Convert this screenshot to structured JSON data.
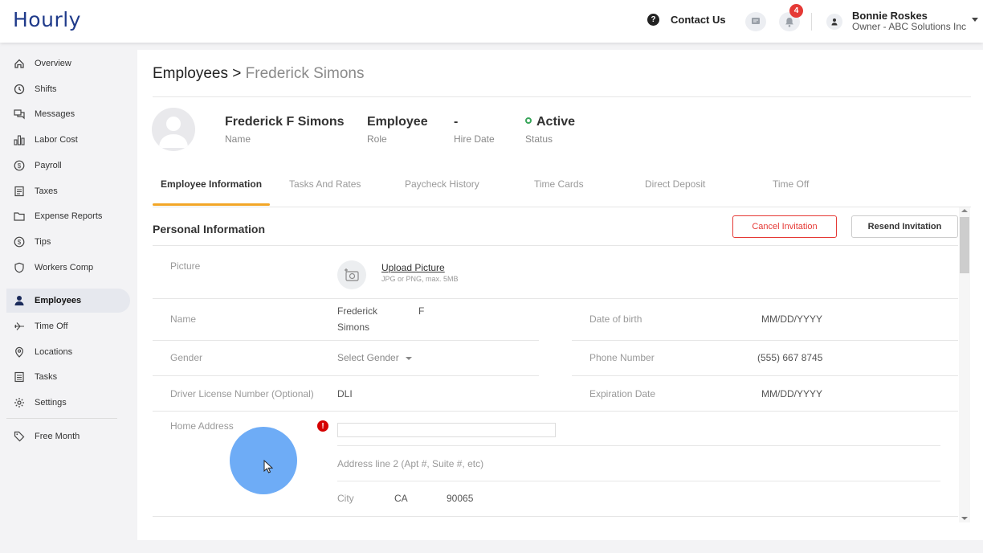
{
  "app": {
    "logo": "Hourly"
  },
  "topbar": {
    "contact_label": "Contact Us",
    "notifications_count": "4",
    "user_name": "Bonnie Roskes",
    "user_role": "Owner - ABC Solutions Inc",
    "icons": [
      "help-icon",
      "chat-icon",
      "bell-icon",
      "user-icon",
      "caret-down-icon"
    ]
  },
  "sidebar": {
    "items": [
      {
        "label": "Overview",
        "icon": "home-icon"
      },
      {
        "label": "Shifts",
        "icon": "clock-icon"
      },
      {
        "label": "Messages",
        "icon": "messages-icon"
      },
      {
        "label": "Labor Cost",
        "icon": "bar-chart-icon"
      },
      {
        "label": "Payroll",
        "icon": "dollar-circle-icon"
      },
      {
        "label": "Taxes",
        "icon": "document-icon"
      },
      {
        "label": "Expense Reports",
        "icon": "folder-icon"
      },
      {
        "label": "Tips",
        "icon": "dollar-circle-icon"
      },
      {
        "label": "Workers Comp",
        "icon": "shield-icon"
      },
      {
        "label": "Employees",
        "icon": "person-icon",
        "active": true
      },
      {
        "label": "Time Off",
        "icon": "plane-icon"
      },
      {
        "label": "Locations",
        "icon": "location-pin-icon"
      },
      {
        "label": "Tasks",
        "icon": "list-icon"
      },
      {
        "label": "Settings",
        "icon": "gear-icon"
      }
    ],
    "free_month": {
      "label": "Free Month",
      "icon": "tag-icon"
    }
  },
  "page": {
    "breadcrumb_root": "Employees",
    "breadcrumb_sep": " > ",
    "breadcrumb_current": "Frederick Simons"
  },
  "employee_summary": {
    "name_value": "Frederick F Simons",
    "name_label": "Name",
    "role_value": "Employee",
    "role_label": "Role",
    "hire_value": "-",
    "hire_label": "Hire Date",
    "status_value": "Active",
    "status_label": "Status"
  },
  "tabs": [
    {
      "label": "Employee Information",
      "active": true
    },
    {
      "label": "Tasks And Rates"
    },
    {
      "label": "Paycheck History"
    },
    {
      "label": "Time Cards"
    },
    {
      "label": "Direct Deposit"
    },
    {
      "label": "Time Off"
    }
  ],
  "personal_info": {
    "title": "Personal Information",
    "cancel_invitation": "Cancel Invitation",
    "resend_invitation": "Resend Invitation",
    "picture_label": "Picture",
    "upload_picture": "Upload Picture",
    "upload_hint": "JPG or PNG, max. 5MB",
    "name_label": "Name",
    "first_name": "Frederick",
    "middle_initial": "F",
    "last_name": "Simons",
    "dob_label": "Date of birth",
    "dob_value": "MM/DD/YYYY",
    "gender_label": "Gender",
    "gender_value": "Select Gender",
    "phone_label": "Phone Number",
    "phone_value": "(555) 667 8745",
    "license_label": "Driver License Number (Optional)",
    "license_value": "DLI",
    "expiration_label": "Expiration Date",
    "expiration_value": "MM/DD/YYYY",
    "home_address_label": "Home Address",
    "address_line1": "",
    "address_line2_placeholder": "Address line 2 (Apt #, Suite #, etc)",
    "city_placeholder": "City",
    "state_value": "CA",
    "zip_value": "90065"
  },
  "colors": {
    "accent_tab": "#f2a627",
    "danger": "#e53935",
    "active_status": "#3aa65b",
    "logo": "#1f3a8a"
  }
}
